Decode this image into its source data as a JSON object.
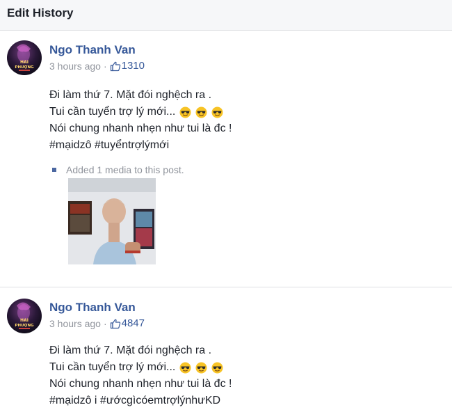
{
  "header": {
    "title": "Edit History"
  },
  "entries": [
    {
      "author": "Ngo Thanh Van",
      "time": "3 hours ago",
      "separator": "·",
      "likes": "1310",
      "lines": [
        "Đi làm thứ 7. Mặt đói nghệch ra .",
        "Tui cần tuyển trợ lý mới...",
        "Nói chung nhanh nhẹn như tui là đc !",
        "#mạidzô #tuyểntrợlýmới"
      ],
      "emoji_count": 3,
      "emoji": "smiling-face-with-sunglasses",
      "media_note": "Added 1 media to this post.",
      "avatar_text": [
        "HAI",
        "PHƯỢNG"
      ]
    },
    {
      "author": "Ngo Thanh Van",
      "time": "3 hours ago",
      "separator": "·",
      "likes": "4847",
      "lines": [
        "Đi làm thứ 7. Mặt đói nghệch ra .",
        "Tui cần tuyển trợ lý mới...",
        "Nói chung nhanh nhẹn như tui là đc !",
        "#mạidzô i #ướcgìcóemtrợlýnhưKD"
      ],
      "emoji_count": 3,
      "emoji": "smiling-face-with-sunglasses",
      "avatar_text": [
        "HAI",
        "PHƯỢNG"
      ]
    }
  ],
  "colors": {
    "link": "#365899",
    "meta": "#90949c",
    "header_bg": "#f6f7f9",
    "divider": "#dddfe2"
  }
}
